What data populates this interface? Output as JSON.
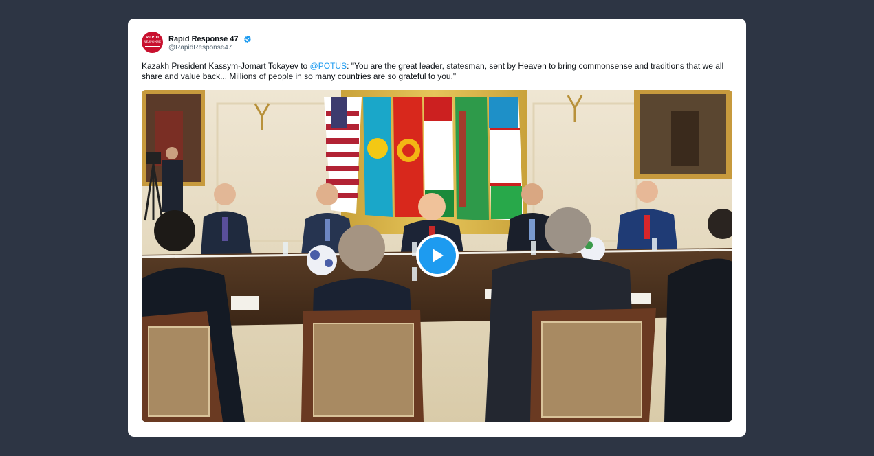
{
  "account": {
    "display_name": "Rapid Response 47",
    "handle": "@RapidResponse47",
    "verified": true,
    "avatar_text_1": "RAPID",
    "avatar_text_2": "RESPONSE"
  },
  "tweet": {
    "text_before": "Kazakh President Kassym-Jomart Tokayev to ",
    "mention": "@POTUS",
    "text_after": ": \"You are the great leader, statesman, sent by Heaven to bring commonsense and traditions that we all share and value back... Millions of people in so many countries are so grateful to you.\""
  },
  "media": {
    "type": "video",
    "play_icon": "play-icon"
  },
  "colors": {
    "background": "#2d3544",
    "card": "#ffffff",
    "accent": "#1d9bf0",
    "avatar": "#c8102e"
  }
}
